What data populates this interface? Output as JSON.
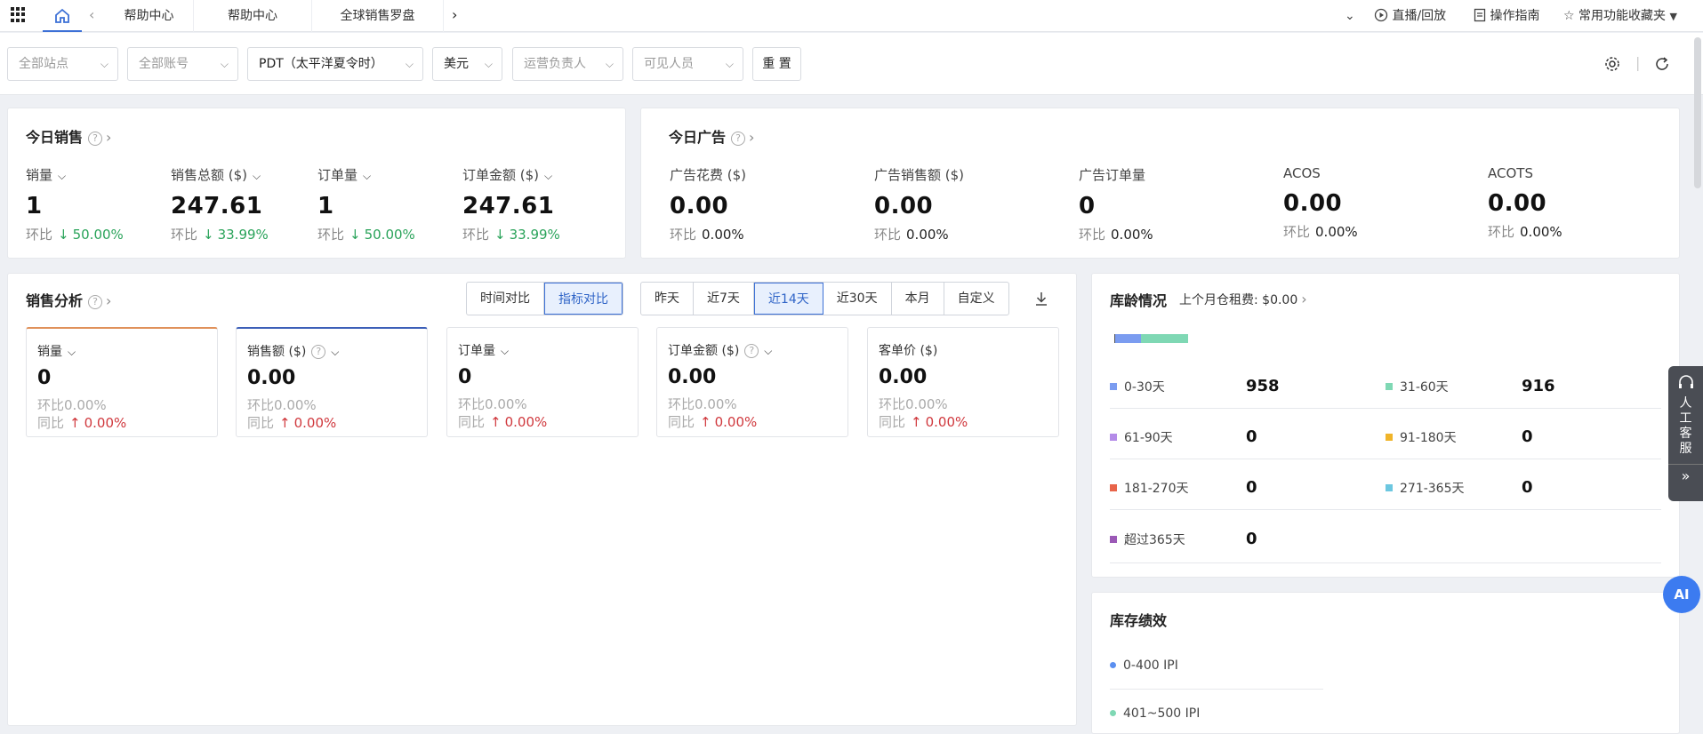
{
  "tabs": {
    "items": [
      "帮助中心",
      "帮助中心",
      "全球销售罗盘"
    ],
    "right": {
      "dropdown": "",
      "live": "直播/回放",
      "guide": "操作指南",
      "favorites": "常用功能收藏夹"
    }
  },
  "filters": {
    "site": "全部站点",
    "account": "全部账号",
    "timezone": "PDT（太平洋夏令时）",
    "currency": "美元",
    "owner": "运营负责人",
    "visible": "可见人员",
    "reset": "重 置"
  },
  "today_sales": {
    "title": "今日销售",
    "metrics": [
      {
        "label": "销量",
        "value": "1",
        "cmp_label": "环比",
        "cmp": "50.00%"
      },
      {
        "label": "销售总额 ($)",
        "value": "247.61",
        "cmp_label": "环比",
        "cmp": "33.99%"
      },
      {
        "label": "订单量",
        "value": "1",
        "cmp_label": "环比",
        "cmp": "50.00%"
      },
      {
        "label": "订单金额 ($)",
        "value": "247.61",
        "cmp_label": "环比",
        "cmp": "33.99%"
      }
    ]
  },
  "today_ads": {
    "title": "今日广告",
    "metrics": [
      {
        "label": "广告花费 ($)",
        "value": "0.00",
        "cmp_label": "环比",
        "cmp": "0.00%"
      },
      {
        "label": "广告销售额 ($)",
        "value": "0.00",
        "cmp_label": "环比",
        "cmp": "0.00%"
      },
      {
        "label": "广告订单量",
        "value": "0",
        "cmp_label": "环比",
        "cmp": "0.00%"
      },
      {
        "label": "ACOS",
        "value": "0.00",
        "cmp_label": "环比",
        "cmp": "0.00%"
      },
      {
        "label": "ACOTS",
        "value": "0.00",
        "cmp_label": "环比",
        "cmp": "0.00%"
      }
    ]
  },
  "sales_analysis": {
    "title": "销售分析",
    "compare_modes": [
      "时间对比",
      "指标对比"
    ],
    "ranges": [
      "昨天",
      "近7天",
      "近14天",
      "近30天",
      "本月",
      "自定义"
    ],
    "kpis": [
      {
        "label": "销量",
        "value": "0",
        "hb_label": "环比",
        "hb": "0.00%",
        "tb_label": "同比",
        "tb": "0.00%"
      },
      {
        "label": "销售额 ($)",
        "value": "0.00",
        "hb_label": "环比",
        "hb": "0.00%",
        "tb_label": "同比",
        "tb": "0.00%"
      },
      {
        "label": "订单量",
        "value": "0",
        "hb_label": "环比",
        "hb": "0.00%",
        "tb_label": "同比",
        "tb": "0.00%"
      },
      {
        "label": "订单金额 ($)",
        "value": "0.00",
        "hb_label": "环比",
        "hb": "0.00%",
        "tb_label": "同比",
        "tb": "0.00%"
      },
      {
        "label": "客单价 ($)",
        "value": "0.00",
        "hb_label": "环比",
        "hb": "0.00%",
        "tb_label": "同比",
        "tb": "0.00%"
      }
    ]
  },
  "inventory_age": {
    "title": "库龄情况",
    "rent": "上个月仓租费: $0.00",
    "buckets": [
      {
        "label": "0-30天",
        "value": "958",
        "color": "#7b9cf0"
      },
      {
        "label": "31-60天",
        "value": "916",
        "color": "#7fd8b4"
      },
      {
        "label": "61-90天",
        "value": "0",
        "color": "#b48be8"
      },
      {
        "label": "91-180天",
        "value": "0",
        "color": "#f0b429"
      },
      {
        "label": "181-270天",
        "value": "0",
        "color": "#e8644a"
      },
      {
        "label": "271-365天",
        "value": "0",
        "color": "#6cc7e0"
      },
      {
        "label": "超过365天",
        "value": "0",
        "color": "#9b59b6"
      }
    ]
  },
  "inventory_perf": {
    "title": "库存绩效",
    "items": [
      {
        "label": "0-400 IPI",
        "color": "#5b8ff0"
      },
      {
        "label": "401~500 IPI",
        "color": "#7fd8b4"
      }
    ]
  },
  "side": {
    "service": "人工客服",
    "ai": "AI"
  }
}
